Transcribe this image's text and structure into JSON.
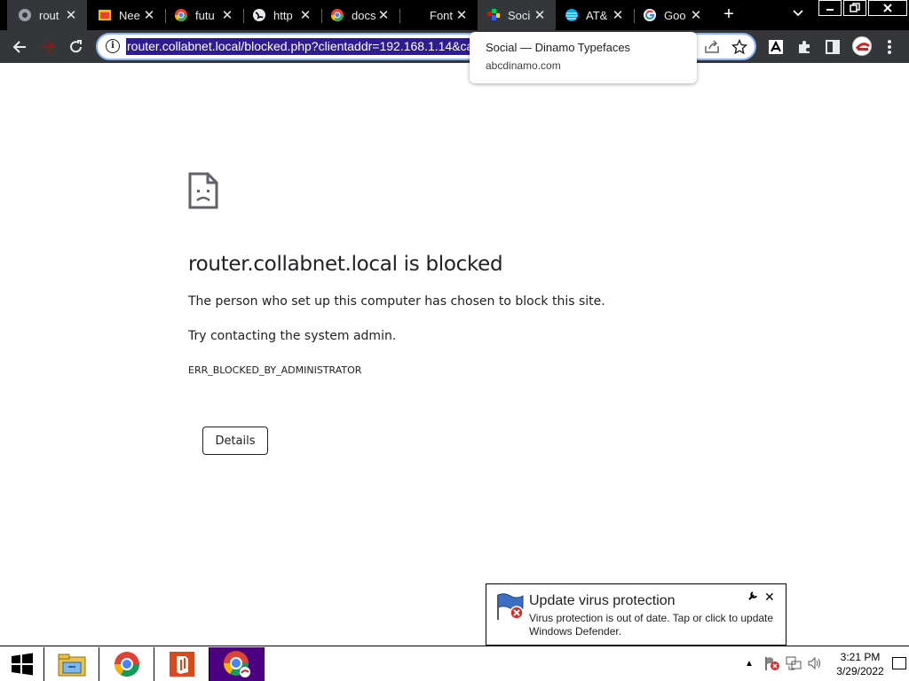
{
  "browser": {
    "tabs": [
      {
        "title": "router.collabnet.local",
        "short": "rout",
        "icon": "chrome-error-icon"
      },
      {
        "title": "Need",
        "short": "Nee",
        "icon": "photo-favicon"
      },
      {
        "title": "future",
        "short": "futu",
        "icon": "colorful-favicon"
      },
      {
        "title": "https",
        "short": "http",
        "icon": "globe-icon"
      },
      {
        "title": "docs",
        "short": "docs",
        "icon": "colorful-favicon"
      },
      {
        "title": "Fonts",
        "short": "Font",
        "icon": "blank-favicon"
      },
      {
        "title": "Social — Dinamo Typefaces",
        "short": "Soci",
        "icon": "dinamo-favicon"
      },
      {
        "title": "AT&T",
        "short": "AT&",
        "icon": "att-icon"
      },
      {
        "title": "Google",
        "short": "Goo",
        "icon": "google-icon"
      }
    ],
    "active_tab_index": 0,
    "new_tab_label": "+",
    "address_bar": {
      "url": "router.collabnet.local/blocked.php?clientaddr=192.168.1.14&ca"
    },
    "tooltip": {
      "title": "Social — Dinamo Typefaces",
      "domain": "abcdinamo.com"
    }
  },
  "page": {
    "heading": "router.collabnet.local is blocked",
    "message": "The person who set up this computer has chosen to block this site.",
    "suggestion": "Try contacting the system admin.",
    "error_code": "ERR_BLOCKED_BY_ADMINISTRATOR",
    "details_button": "Details"
  },
  "notification": {
    "title": "Update virus protection",
    "body": "Virus protection is out of date. Tap or click to update Windows Defender."
  },
  "taskbar": {
    "apps": [
      "file-explorer",
      "chrome",
      "office",
      "chrome-profile"
    ],
    "time": "3:21 PM",
    "date": "3/29/2022"
  },
  "colors": {
    "tab_strip": "#000000",
    "toolbar": "#35363a",
    "url_highlight": "#311b92",
    "taskbar_active": "#4b0082"
  }
}
